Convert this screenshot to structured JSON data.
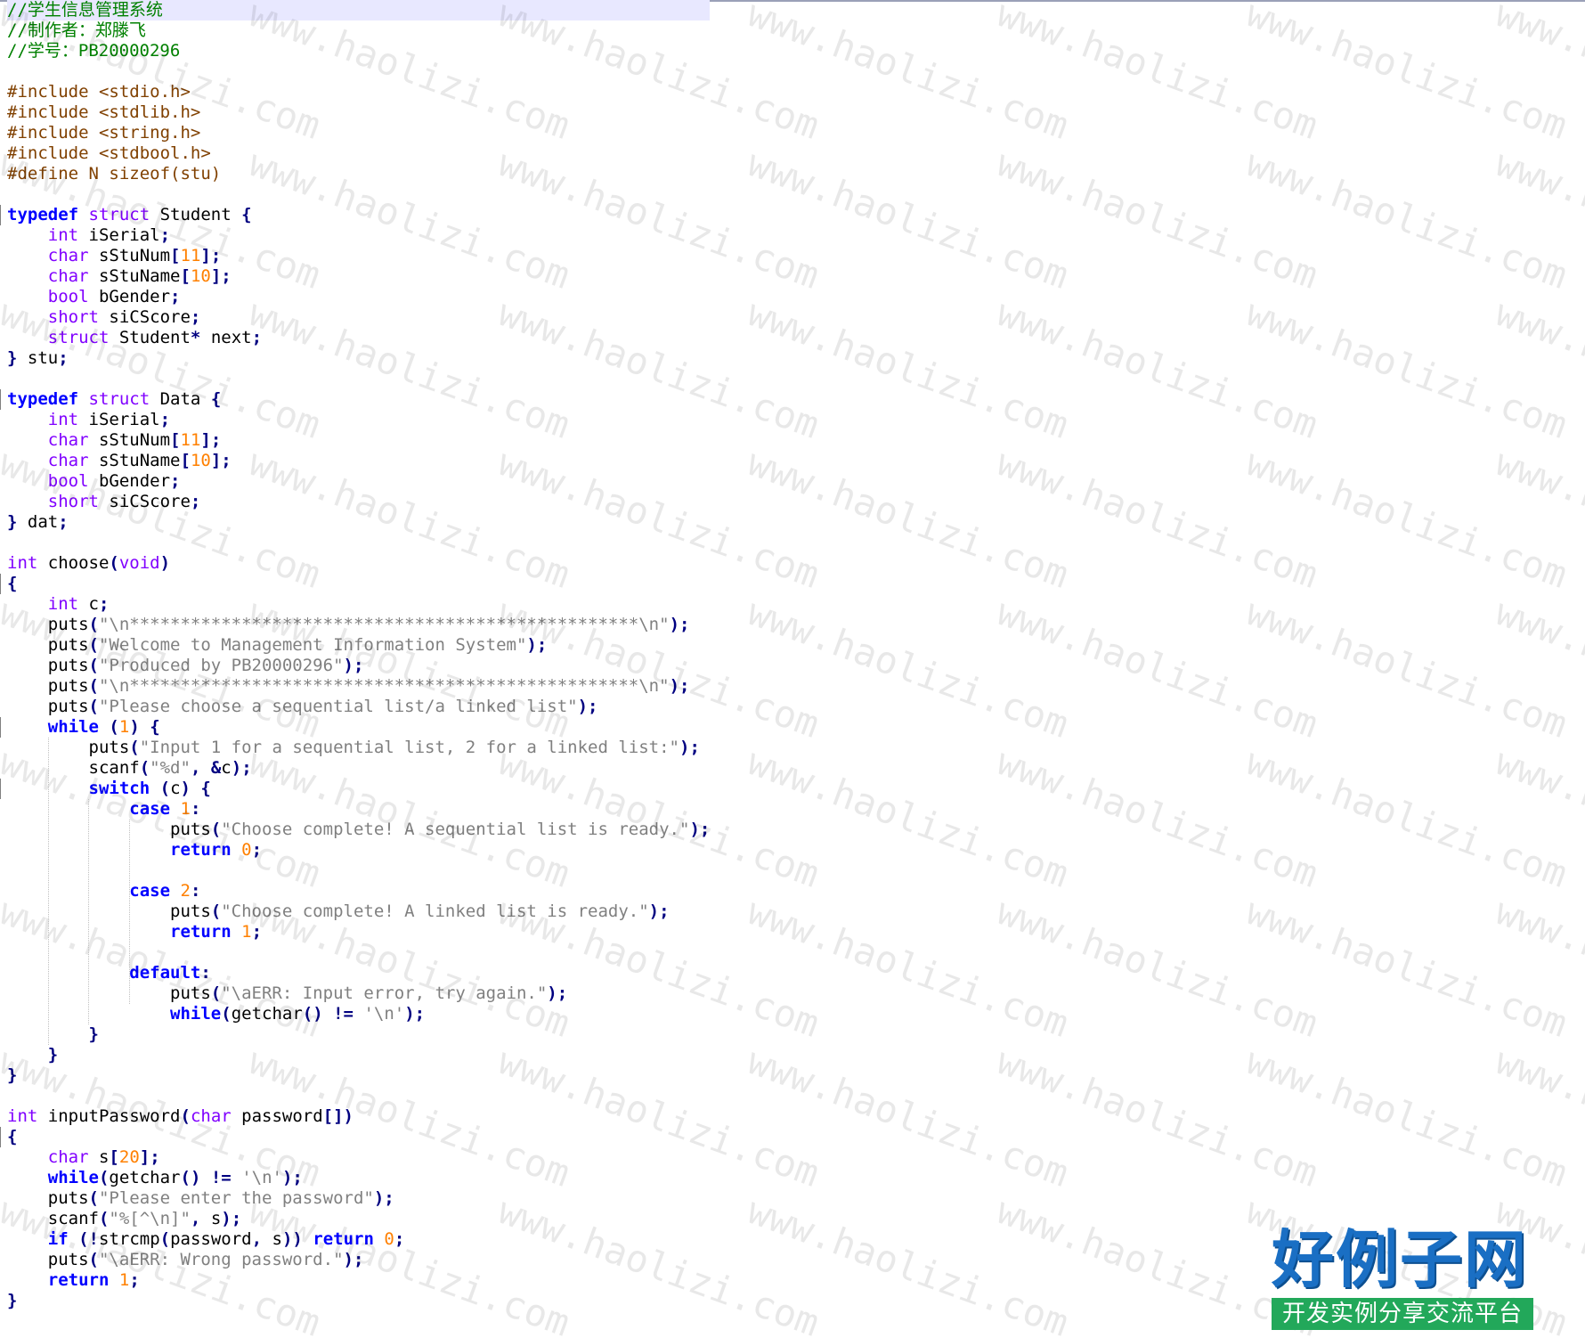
{
  "colors": {
    "comment": "#008000",
    "preprocessor": "#804000",
    "keyword_bold": "#0000ff",
    "type": "#8000ff",
    "number": "#ff8000",
    "string": "#808080",
    "operator": "#000080",
    "text": "#000000",
    "current_line_bg": "#e8e8ff",
    "logo_blue": "#1a6fc4",
    "logo_green": "#22a85a"
  },
  "watermark": {
    "text": "www.haolizi.com"
  },
  "logo": {
    "title": "好例子网",
    "subtitle": "开发实例分享交流平台"
  },
  "code_lines": [
    [
      [
        "//学生信息管理系统",
        "c"
      ]
    ],
    [
      [
        "//制作者：郑滕飞",
        "c"
      ]
    ],
    [
      [
        "//学号：PB20000296",
        "c"
      ]
    ],
    [],
    [
      [
        "#include <stdio.h>",
        "p"
      ]
    ],
    [
      [
        "#include <stdlib.h>",
        "p"
      ]
    ],
    [
      [
        "#include <string.h>",
        "p"
      ]
    ],
    [
      [
        "#include <stdbool.h>",
        "p"
      ]
    ],
    [
      [
        "#define N sizeof(stu)",
        "p"
      ]
    ],
    [],
    [
      [
        "typedef",
        "k"
      ],
      [
        " ",
        ""
      ],
      [
        "struct",
        "t"
      ],
      [
        " Student ",
        ""
      ],
      [
        "{",
        "o"
      ]
    ],
    [
      [
        "    ",
        ""
      ],
      [
        "int",
        "t"
      ],
      [
        " iSerial",
        ""
      ],
      [
        ";",
        "o"
      ]
    ],
    [
      [
        "    ",
        ""
      ],
      [
        "char",
        "t"
      ],
      [
        " sStuNum",
        ""
      ],
      [
        "[",
        "o"
      ],
      [
        "11",
        "n"
      ],
      [
        "];",
        "o"
      ]
    ],
    [
      [
        "    ",
        ""
      ],
      [
        "char",
        "t"
      ],
      [
        " sStuName",
        ""
      ],
      [
        "[",
        "o"
      ],
      [
        "10",
        "n"
      ],
      [
        "];",
        "o"
      ]
    ],
    [
      [
        "    ",
        ""
      ],
      [
        "bool",
        "t"
      ],
      [
        " bGender",
        ""
      ],
      [
        ";",
        "o"
      ]
    ],
    [
      [
        "    ",
        ""
      ],
      [
        "short",
        "t"
      ],
      [
        " siCScore",
        ""
      ],
      [
        ";",
        "o"
      ]
    ],
    [
      [
        "    ",
        ""
      ],
      [
        "struct",
        "t"
      ],
      [
        " Student",
        ""
      ],
      [
        "*",
        "o"
      ],
      [
        " next",
        ""
      ],
      [
        ";",
        "o"
      ]
    ],
    [
      [
        "}",
        "o"
      ],
      [
        " stu",
        ""
      ],
      [
        ";",
        "o"
      ]
    ],
    [],
    [
      [
        "typedef",
        "k"
      ],
      [
        " ",
        ""
      ],
      [
        "struct",
        "t"
      ],
      [
        " Data ",
        ""
      ],
      [
        "{",
        "o"
      ]
    ],
    [
      [
        "    ",
        ""
      ],
      [
        "int",
        "t"
      ],
      [
        " iSerial",
        ""
      ],
      [
        ";",
        "o"
      ]
    ],
    [
      [
        "    ",
        ""
      ],
      [
        "char",
        "t"
      ],
      [
        " sStuNum",
        ""
      ],
      [
        "[",
        "o"
      ],
      [
        "11",
        "n"
      ],
      [
        "];",
        "o"
      ]
    ],
    [
      [
        "    ",
        ""
      ],
      [
        "char",
        "t"
      ],
      [
        " sStuName",
        ""
      ],
      [
        "[",
        "o"
      ],
      [
        "10",
        "n"
      ],
      [
        "];",
        "o"
      ]
    ],
    [
      [
        "    ",
        ""
      ],
      [
        "bool",
        "t"
      ],
      [
        " bGender",
        ""
      ],
      [
        ";",
        "o"
      ]
    ],
    [
      [
        "    ",
        ""
      ],
      [
        "short",
        "t"
      ],
      [
        " siCScore",
        ""
      ],
      [
        ";",
        "o"
      ]
    ],
    [
      [
        "}",
        "o"
      ],
      [
        " dat",
        ""
      ],
      [
        ";",
        "o"
      ]
    ],
    [],
    [
      [
        "int",
        "t"
      ],
      [
        " choose",
        ""
      ],
      [
        "(",
        "o"
      ],
      [
        "void",
        "t"
      ],
      [
        ")",
        "o"
      ]
    ],
    [
      [
        "{",
        "o"
      ]
    ],
    [
      [
        "    ",
        ""
      ],
      [
        "int",
        "t"
      ],
      [
        " c",
        ""
      ],
      [
        ";",
        "o"
      ]
    ],
    [
      [
        "    puts",
        ""
      ],
      [
        "(",
        "o"
      ],
      [
        "\"\\n**************************************************\\n\"",
        "s"
      ],
      [
        ");",
        "o"
      ]
    ],
    [
      [
        "    puts",
        ""
      ],
      [
        "(",
        "o"
      ],
      [
        "\"Welcome to Management Information System\"",
        "s"
      ],
      [
        ");",
        "o"
      ]
    ],
    [
      [
        "    puts",
        ""
      ],
      [
        "(",
        "o"
      ],
      [
        "\"Produced by PB20000296\"",
        "s"
      ],
      [
        ");",
        "o"
      ]
    ],
    [
      [
        "    puts",
        ""
      ],
      [
        "(",
        "o"
      ],
      [
        "\"\\n**************************************************\\n\"",
        "s"
      ],
      [
        ");",
        "o"
      ]
    ],
    [
      [
        "    puts",
        ""
      ],
      [
        "(",
        "o"
      ],
      [
        "\"Please choose a sequential list/a linked list\"",
        "s"
      ],
      [
        ");",
        "o"
      ]
    ],
    [
      [
        "    ",
        ""
      ],
      [
        "while",
        "k"
      ],
      [
        " ",
        ""
      ],
      [
        "(",
        "o"
      ],
      [
        "1",
        "n"
      ],
      [
        ")",
        "o"
      ],
      [
        " ",
        ""
      ],
      [
        "{",
        "o"
      ]
    ],
    [
      [
        "        puts",
        ""
      ],
      [
        "(",
        "o"
      ],
      [
        "\"Input 1 for a sequential list, 2 for a linked list:\"",
        "s"
      ],
      [
        ");",
        "o"
      ]
    ],
    [
      [
        "        scanf",
        ""
      ],
      [
        "(",
        "o"
      ],
      [
        "\"%d\"",
        "s"
      ],
      [
        ",",
        "o"
      ],
      [
        " ",
        ""
      ],
      [
        "&",
        "o"
      ],
      [
        "c",
        ""
      ],
      [
        ");",
        "o"
      ]
    ],
    [
      [
        "        ",
        ""
      ],
      [
        "switch",
        "k"
      ],
      [
        " ",
        ""
      ],
      [
        "(",
        "o"
      ],
      [
        "c",
        ""
      ],
      [
        ")",
        "o"
      ],
      [
        " ",
        ""
      ],
      [
        "{",
        "o"
      ]
    ],
    [
      [
        "            ",
        ""
      ],
      [
        "case",
        "k"
      ],
      [
        " ",
        ""
      ],
      [
        "1",
        "n"
      ],
      [
        ":",
        "o"
      ]
    ],
    [
      [
        "                puts",
        ""
      ],
      [
        "(",
        "o"
      ],
      [
        "\"Choose complete! A sequential list is ready.\"",
        "s"
      ],
      [
        ");",
        "o"
      ]
    ],
    [
      [
        "                ",
        ""
      ],
      [
        "return",
        "k"
      ],
      [
        " ",
        ""
      ],
      [
        "0",
        "n"
      ],
      [
        ";",
        "o"
      ]
    ],
    [],
    [
      [
        "            ",
        ""
      ],
      [
        "case",
        "k"
      ],
      [
        " ",
        ""
      ],
      [
        "2",
        "n"
      ],
      [
        ":",
        "o"
      ]
    ],
    [
      [
        "                puts",
        ""
      ],
      [
        "(",
        "o"
      ],
      [
        "\"Choose complete! A linked list is ready.\"",
        "s"
      ],
      [
        ");",
        "o"
      ]
    ],
    [
      [
        "                ",
        ""
      ],
      [
        "return",
        "k"
      ],
      [
        " ",
        ""
      ],
      [
        "1",
        "n"
      ],
      [
        ";",
        "o"
      ]
    ],
    [],
    [
      [
        "            ",
        ""
      ],
      [
        "default",
        "k"
      ],
      [
        ":",
        "o"
      ]
    ],
    [
      [
        "                puts",
        ""
      ],
      [
        "(",
        "o"
      ],
      [
        "\"\\aERR: Input error, try again.\"",
        "s"
      ],
      [
        ");",
        "o"
      ]
    ],
    [
      [
        "                ",
        ""
      ],
      [
        "while",
        "k"
      ],
      [
        "(",
        "o"
      ],
      [
        "getchar",
        ""
      ],
      [
        "()",
        "o"
      ],
      [
        " ",
        ""
      ],
      [
        "!=",
        "o"
      ],
      [
        " ",
        ""
      ],
      [
        "'\\n'",
        "s"
      ],
      [
        ");",
        "o"
      ]
    ],
    [
      [
        "        ",
        ""
      ],
      [
        "}",
        "o"
      ]
    ],
    [
      [
        "    ",
        ""
      ],
      [
        "}",
        "o"
      ]
    ],
    [
      [
        "}",
        "o"
      ]
    ],
    [],
    [
      [
        "int",
        "t"
      ],
      [
        " inputPassword",
        ""
      ],
      [
        "(",
        "o"
      ],
      [
        "char",
        "t"
      ],
      [
        " password",
        ""
      ],
      [
        "[])",
        "o"
      ]
    ],
    [
      [
        "{",
        "o"
      ]
    ],
    [
      [
        "    ",
        ""
      ],
      [
        "char",
        "t"
      ],
      [
        " s",
        ""
      ],
      [
        "[",
        "o"
      ],
      [
        "20",
        "n"
      ],
      [
        "];",
        "o"
      ]
    ],
    [
      [
        "    ",
        ""
      ],
      [
        "while",
        "k"
      ],
      [
        "(",
        "o"
      ],
      [
        "getchar",
        ""
      ],
      [
        "()",
        "o"
      ],
      [
        " ",
        ""
      ],
      [
        "!=",
        "o"
      ],
      [
        " ",
        ""
      ],
      [
        "'\\n'",
        "s"
      ],
      [
        ");",
        "o"
      ]
    ],
    [
      [
        "    puts",
        ""
      ],
      [
        "(",
        "o"
      ],
      [
        "\"Please enter the password\"",
        "s"
      ],
      [
        ");",
        "o"
      ]
    ],
    [
      [
        "    scanf",
        ""
      ],
      [
        "(",
        "o"
      ],
      [
        "\"%[^\\n]\"",
        "s"
      ],
      [
        ",",
        "o"
      ],
      [
        " s",
        ""
      ],
      [
        ");",
        "o"
      ]
    ],
    [
      [
        "    ",
        ""
      ],
      [
        "if",
        "k"
      ],
      [
        " ",
        ""
      ],
      [
        "(!",
        "o"
      ],
      [
        "strcmp",
        ""
      ],
      [
        "(",
        "o"
      ],
      [
        "password",
        ""
      ],
      [
        ",",
        "o"
      ],
      [
        " s",
        ""
      ],
      [
        "))",
        "o"
      ],
      [
        " ",
        ""
      ],
      [
        "return",
        "k"
      ],
      [
        " ",
        ""
      ],
      [
        "0",
        "n"
      ],
      [
        ";",
        "o"
      ]
    ],
    [
      [
        "    puts",
        ""
      ],
      [
        "(",
        "o"
      ],
      [
        "\"\\aERR: Wrong password.\"",
        "s"
      ],
      [
        ");",
        "o"
      ]
    ],
    [
      [
        "    ",
        ""
      ],
      [
        "return",
        "k"
      ],
      [
        " ",
        ""
      ],
      [
        "1",
        "n"
      ],
      [
        ";",
        "o"
      ]
    ],
    [
      [
        "}",
        "o"
      ]
    ]
  ]
}
